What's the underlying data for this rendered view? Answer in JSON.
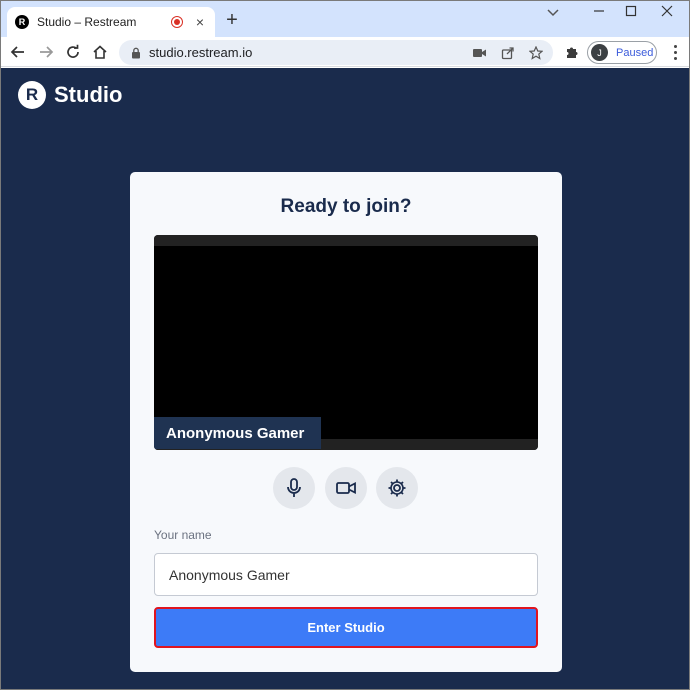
{
  "browser": {
    "tab": {
      "title": "Studio – Restream",
      "favicon_letter": "R"
    },
    "url": "studio.restream.io",
    "profile": {
      "initial": "J",
      "status": "Paused"
    }
  },
  "page": {
    "logo": {
      "mark": "R",
      "text": "Studio"
    },
    "card": {
      "title": "Ready to join?",
      "preview_name_tag": "Anonymous Gamer",
      "controls": [
        "microphone-icon",
        "camera-icon",
        "settings-gear-icon"
      ],
      "name_label": "Your name",
      "name_value": "Anonymous Gamer",
      "enter_button": "Enter Studio"
    }
  },
  "colors": {
    "page_bg": "#1a2b4c",
    "card_bg": "#f7f9fc",
    "primary_button": "#3d7bf7",
    "highlight_border": "#e0151f"
  }
}
